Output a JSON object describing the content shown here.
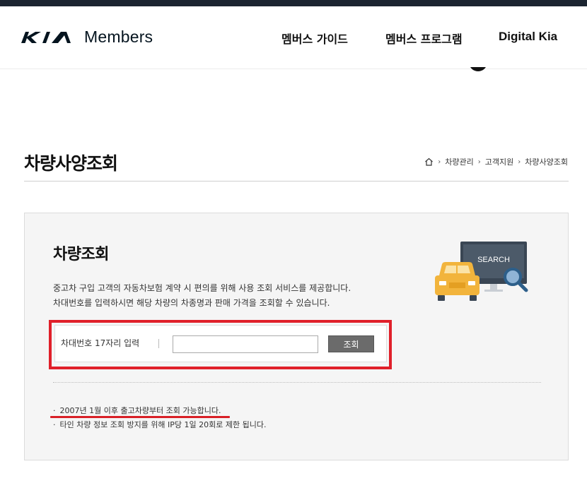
{
  "header": {
    "brand": "Members",
    "nav": [
      "멤버스 가이드",
      "멤버스 프로그램",
      "Digital Kia"
    ]
  },
  "page": {
    "title": "차량사양조회",
    "breadcrumb": [
      "차량관리",
      "고객지원",
      "차량사양조회"
    ]
  },
  "panel": {
    "title": "차량조회",
    "description": [
      "중고차 구입 고객의 자동차보험 계약 시 편의를 위해 사용 조회 서비스를 제공합니다.",
      "차대번호를 입력하시면 해당 차량의 차종명과 판매 가격을 조회할 수 있습니다."
    ],
    "illustration_text": "SEARCH",
    "search": {
      "label": "차대번호 17자리 입력",
      "value": "",
      "button": "조회"
    },
    "notes": [
      "2007년 1월 이후 출고차량부터 조회 가능합니다.",
      "타인 차량 정보 조회 방지를 위해 IP당 1일 20회로 제한 됩니다."
    ]
  },
  "colors": {
    "highlight": "#e0202a",
    "button": "#6b6b6b",
    "topbar": "#1b2430"
  }
}
